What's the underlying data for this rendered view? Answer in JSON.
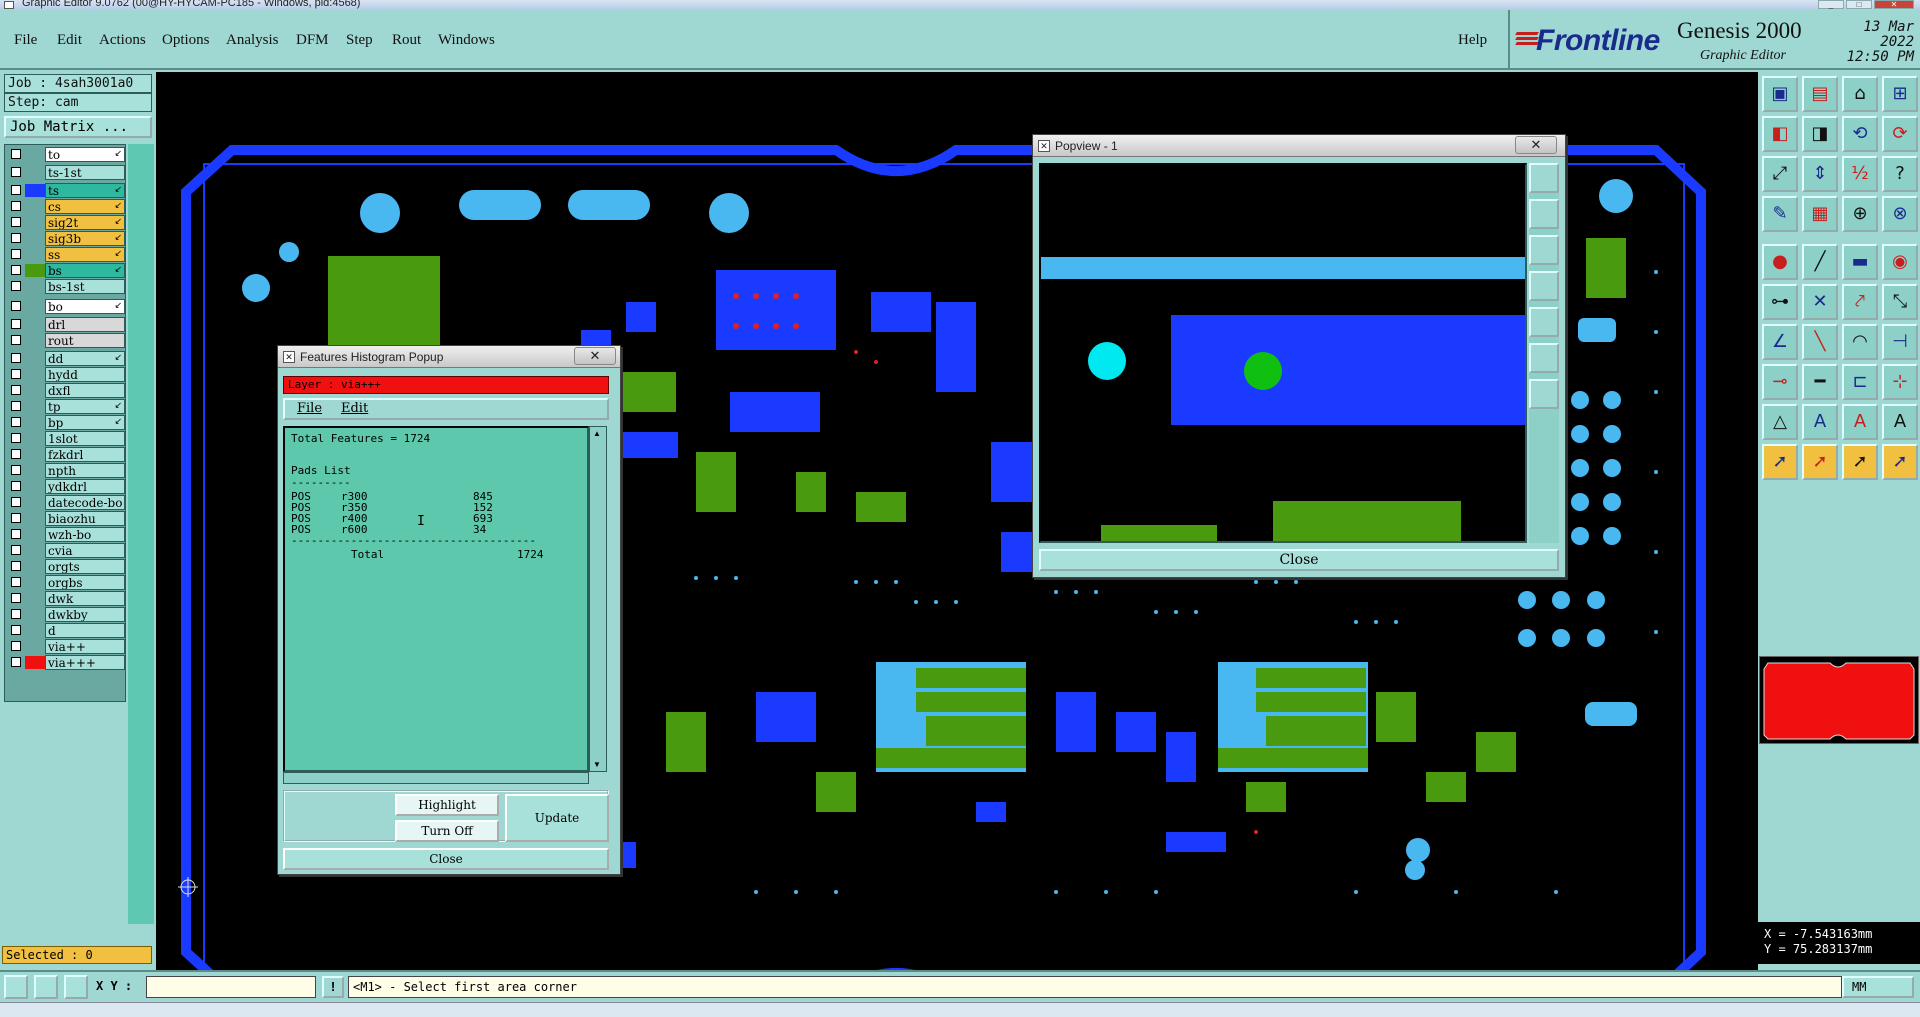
{
  "os_title": "Graphic Editor 9.0762 (00@HY-HYCAM-PC185 - Windows, pid:4568)",
  "menu": {
    "items": [
      "File",
      "Edit",
      "Actions",
      "Options",
      "Analysis",
      "DFM",
      "Step",
      "Rout",
      "Windows"
    ],
    "help": "Help"
  },
  "brand": {
    "logo": "Frontline",
    "product": "Genesis 2000",
    "subtitle": "Graphic Editor",
    "date": "13 Mar 2022",
    "time": "12:50 PM"
  },
  "job": {
    "job_label": "Job : 4sah3001a0",
    "step_label": "Step: cam",
    "matrix_button": "Job Matrix ..."
  },
  "layers": [
    {
      "name": "to",
      "color": "#ffffff",
      "swatch": "",
      "arrow": true
    },
    {
      "name": "ts-1st",
      "color": "#a8e0da",
      "swatch": "",
      "arrow": false
    },
    {
      "name": "ts",
      "color": "#2fb8a0",
      "swatch": "#1a3aff",
      "arrow": true
    },
    {
      "name": "cs",
      "color": "#f2c040",
      "swatch": "",
      "arrow": true
    },
    {
      "name": "sig2t",
      "color": "#f2c040",
      "swatch": "",
      "arrow": true
    },
    {
      "name": "sig3b",
      "color": "#f2c040",
      "swatch": "",
      "arrow": true
    },
    {
      "name": "ss",
      "color": "#f2c040",
      "swatch": "",
      "arrow": true
    },
    {
      "name": "bs",
      "color": "#2fb8a0",
      "swatch": "#4a9a10",
      "arrow": true
    },
    {
      "name": "bs-1st",
      "color": "#a8e0da",
      "swatch": "",
      "arrow": false
    },
    {
      "name": "bo",
      "color": "#ffffff",
      "swatch": "",
      "arrow": true
    },
    {
      "name": "drl",
      "color": "#d8d8d8",
      "swatch": "",
      "arrow": false
    },
    {
      "name": "rout",
      "color": "#d8d8d8",
      "swatch": "",
      "arrow": false
    },
    {
      "name": "dd",
      "color": "#a8e0da",
      "swatch": "",
      "arrow": true
    },
    {
      "name": "hydd",
      "color": "#a8e0da",
      "swatch": "",
      "arrow": false
    },
    {
      "name": "dxfl",
      "color": "#a8e0da",
      "swatch": "",
      "arrow": false
    },
    {
      "name": "tp",
      "color": "#a8e0da",
      "swatch": "",
      "arrow": true
    },
    {
      "name": "bp",
      "color": "#a8e0da",
      "swatch": "",
      "arrow": true
    },
    {
      "name": "1slot",
      "color": "#a8e0da",
      "swatch": "",
      "arrow": false
    },
    {
      "name": "fzkdrl",
      "color": "#a8e0da",
      "swatch": "",
      "arrow": false
    },
    {
      "name": "npth",
      "color": "#a8e0da",
      "swatch": "",
      "arrow": false
    },
    {
      "name": "ydkdrl",
      "color": "#a8e0da",
      "swatch": "",
      "arrow": false
    },
    {
      "name": "datecode-bo",
      "color": "#a8e0da",
      "swatch": "",
      "arrow": false
    },
    {
      "name": "biaozhu",
      "color": "#a8e0da",
      "swatch": "",
      "arrow": false
    },
    {
      "name": "wzh-bo",
      "color": "#a8e0da",
      "swatch": "",
      "arrow": false
    },
    {
      "name": "cvia",
      "color": "#a8e0da",
      "swatch": "",
      "arrow": false
    },
    {
      "name": "orgts",
      "color": "#a8e0da",
      "swatch": "",
      "arrow": false
    },
    {
      "name": "orgbs",
      "color": "#a8e0da",
      "swatch": "",
      "arrow": false
    },
    {
      "name": "dwk",
      "color": "#a8e0da",
      "swatch": "",
      "arrow": false
    },
    {
      "name": "dwkby",
      "color": "#a8e0da",
      "swatch": "",
      "arrow": false
    },
    {
      "name": "d",
      "color": "#a8e0da",
      "swatch": "",
      "arrow": false
    },
    {
      "name": "via++",
      "color": "#a8e0da",
      "swatch": "",
      "arrow": false
    },
    {
      "name": "via+++",
      "color": "#a8e0da",
      "swatch": "#f01010",
      "arrow": false
    }
  ],
  "selected": "Selected : 0",
  "histogram": {
    "title": "Features Histogram Popup",
    "layer_label": "Layer : via+++",
    "menu_file": "File",
    "menu_edit": "Edit",
    "total_features": "Total Features = 1724",
    "list_title": "Pads List",
    "underline": "---------",
    "rows": [
      {
        "kind": "POS",
        "symbol": "r300",
        "count": "845"
      },
      {
        "kind": "POS",
        "symbol": "r350",
        "count": "152"
      },
      {
        "kind": "POS",
        "symbol": "r400",
        "count": "693"
      },
      {
        "kind": "POS",
        "symbol": "r600",
        "count": "34"
      }
    ],
    "separator": "-------------------------------------",
    "total_label": "Total",
    "total_value": "1724",
    "highlight": "Highlight",
    "turn_off": "Turn Off",
    "update": "Update",
    "close": "Close"
  },
  "popview": {
    "title": "Popview - 1",
    "close": "Close"
  },
  "coords": {
    "x": "X = -7.543163mm",
    "y": "Y = 75.283137mm"
  },
  "bottom": {
    "xy_label": "X Y :",
    "xy_value": "",
    "excl": "!",
    "message": "<M1> - Select first area corner",
    "units": "MM"
  },
  "colors": {
    "ui_bg": "#9fd8d2",
    "canvas_bg": "#000000",
    "layer_green": "#4a9a10",
    "layer_blue": "#1a3aff",
    "layer_cyan": "#4ab8f0",
    "highlight_red": "#f01010"
  }
}
